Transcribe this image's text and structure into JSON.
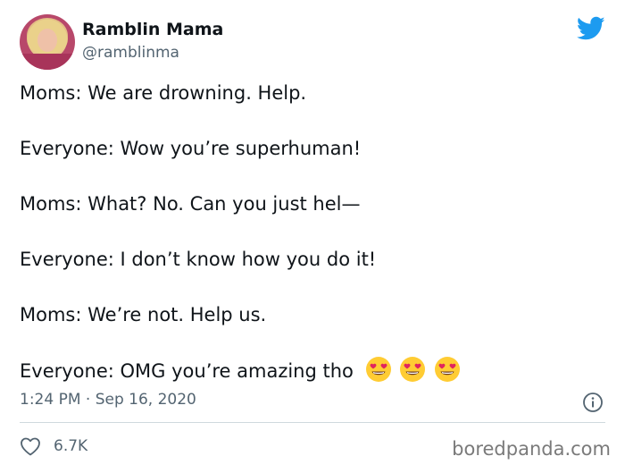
{
  "author": {
    "name": "Ramblin Mama",
    "handle": "@ramblinma"
  },
  "tweet": {
    "lines": [
      "Moms: We are drowning. Help.",
      "Everyone: Wow you’re superhuman!",
      "Moms: What? No. Can you just hel—",
      "Everyone: I don’t know how you do it!",
      "Moms: We’re not. Help us.",
      "Everyone: OMG you’re amazing tho"
    ],
    "emoji": [
      "smiling-face-with-heart-eyes",
      "smiling-face-with-heart-eyes",
      "smiling-face-with-heart-eyes"
    ],
    "timestamp": "1:24 PM · Sep 16, 2020",
    "likes": "6.7K"
  },
  "watermark": "boredpanda.com",
  "colors": {
    "twitter_blue": "#1d9bf0",
    "text": "#0f1419",
    "secondary": "#536471"
  }
}
